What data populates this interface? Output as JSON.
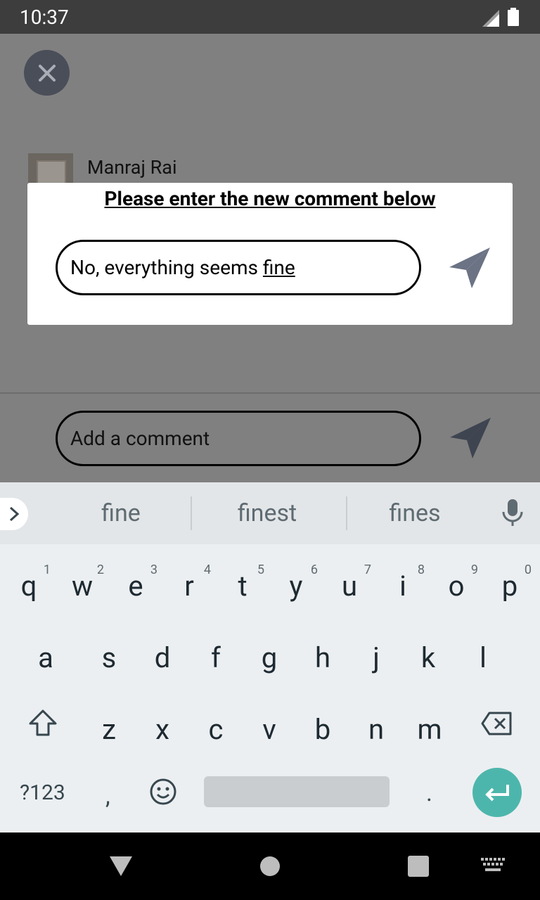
{
  "status": {
    "time": "10:37"
  },
  "post": {
    "author": "Manraj Rai"
  },
  "dialog": {
    "title": "Please enter the new comment below",
    "input_prefix": "No, everything seems ",
    "input_composing": "fine"
  },
  "comment_bar": {
    "placeholder": "Add a comment"
  },
  "keyboard": {
    "suggestions": [
      "fine",
      "finest",
      "fines"
    ],
    "row1": [
      {
        "k": "q",
        "h": "1"
      },
      {
        "k": "w",
        "h": "2"
      },
      {
        "k": "e",
        "h": "3"
      },
      {
        "k": "r",
        "h": "4"
      },
      {
        "k": "t",
        "h": "5"
      },
      {
        "k": "y",
        "h": "6"
      },
      {
        "k": "u",
        "h": "7"
      },
      {
        "k": "i",
        "h": "8"
      },
      {
        "k": "o",
        "h": "9"
      },
      {
        "k": "p",
        "h": "0"
      }
    ],
    "row2": [
      "a",
      "s",
      "d",
      "f",
      "g",
      "h",
      "j",
      "k",
      "l"
    ],
    "row3": [
      "z",
      "x",
      "c",
      "v",
      "b",
      "n",
      "m"
    ],
    "symbols_label": "?123",
    "comma": ",",
    "period": "."
  },
  "colors": {
    "accent": "#4db6ac",
    "send_icon": "#6b7385",
    "close_bg": "#4a4e59"
  }
}
